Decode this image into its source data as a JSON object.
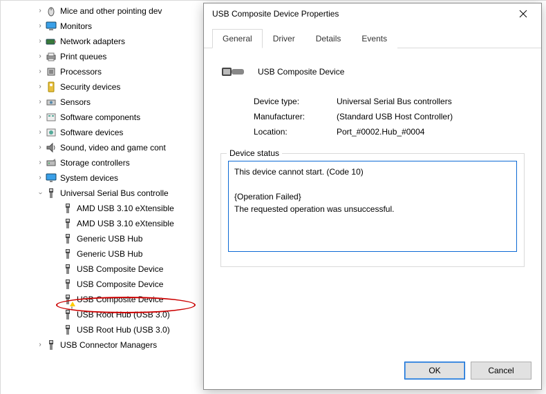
{
  "tree": {
    "mice": "Mice and other pointing dev",
    "monitors": "Monitors",
    "network": "Network adapters",
    "printq": "Print queues",
    "processors": "Processors",
    "security": "Security devices",
    "sensors": "Sensors",
    "swcomp": "Software components",
    "swdev": "Software devices",
    "sound": "Sound, video and game cont",
    "storage": "Storage controllers",
    "sysdev": "System devices",
    "usb": "Universal Serial Bus controlle",
    "usb_children": [
      "AMD USB 3.10 eXtensible",
      "AMD USB 3.10 eXtensible",
      "Generic USB Hub",
      "Generic USB Hub",
      "USB Composite Device",
      "USB Composite Device",
      "USB Composite Device",
      "USB Root Hub (USB 3.0)",
      "USB Root Hub (USB 3.0)"
    ],
    "usbconn": "USB Connector Managers"
  },
  "dialog": {
    "title": "USB Composite Device Properties",
    "tabs": {
      "general": "General",
      "driver": "Driver",
      "details": "Details",
      "events": "Events"
    },
    "device_name": "USB Composite Device",
    "rows": {
      "type_k": "Device type:",
      "type_v": "Universal Serial Bus controllers",
      "manu_k": "Manufacturer:",
      "manu_v": "(Standard USB Host Controller)",
      "loc_k": "Location:",
      "loc_v": "Port_#0002.Hub_#0004"
    },
    "status_legend": "Device status",
    "status_text": "This device cannot start. (Code 10)\n\n{Operation Failed}\nThe requested operation was unsuccessful.",
    "ok": "OK",
    "cancel": "Cancel"
  }
}
